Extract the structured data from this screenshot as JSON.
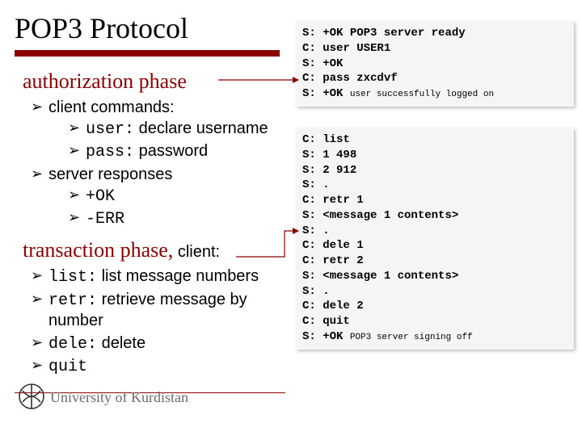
{
  "title": "POP3 Protocol",
  "footer": {
    "text": "University of Kurdistan"
  },
  "left": {
    "phase1_heading": "authorization phase",
    "client_commands_label": "client commands:",
    "user_cmd": "user:",
    "user_desc": " declare username",
    "pass_cmd": "pass:",
    "pass_desc": " password",
    "server_responses_label": "server responses",
    "resp_ok": "+OK",
    "resp_err": "-ERR",
    "phase2_heading": "transaction phase,",
    "phase2_suffix": " client:",
    "list_cmd": "list:",
    "list_desc": " list message numbers",
    "retr_cmd": "retr:",
    "retr_desc": " retrieve message by number",
    "dele_cmd": "dele:",
    "dele_desc": " delete",
    "quit_cmd": "quit"
  },
  "terminal_top": [
    {
      "p": "S:",
      "text": " +OK POP3 server ready",
      "bold": true,
      "small": false
    },
    {
      "p": "C:",
      "text": " user USER1",
      "bold": true,
      "small": false
    },
    {
      "p": "S:",
      "text": " +OK",
      "bold": true,
      "small": false
    },
    {
      "p": "C:",
      "text": " pass zxcdvf",
      "bold": true,
      "small": false
    },
    {
      "p": "S:",
      "text": " +OK ",
      "bold": true,
      "small": false,
      "tail": "user successfully logged on"
    }
  ],
  "terminal_bottom": [
    {
      "p": "C:",
      "text": " list"
    },
    {
      "p": "S:",
      "text": " 1 498"
    },
    {
      "p": "S:",
      "text": " 2 912"
    },
    {
      "p": "S:",
      "text": " ."
    },
    {
      "p": "C:",
      "text": " retr 1"
    },
    {
      "p": "S:",
      "text": " <message 1 contents>"
    },
    {
      "p": "S:",
      "text": " ."
    },
    {
      "p": "C:",
      "text": " dele 1"
    },
    {
      "p": "C:",
      "text": " retr 2"
    },
    {
      "p": "S:",
      "text": " <message 1 contents>"
    },
    {
      "p": "S:",
      "text": " ."
    },
    {
      "p": "C:",
      "text": " dele 2"
    },
    {
      "p": "C:",
      "text": " quit"
    },
    {
      "p": "S:",
      "text": " +OK ",
      "tail": "POP3 server signing off"
    }
  ]
}
